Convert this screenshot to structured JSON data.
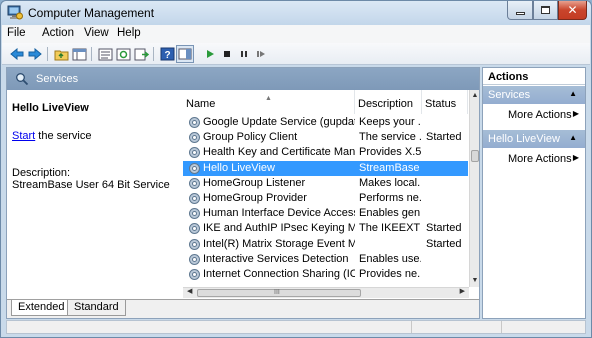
{
  "window": {
    "title": "Computer Management"
  },
  "menu": [
    "File",
    "Action",
    "View",
    "Help"
  ],
  "main": {
    "header_title": "Services",
    "service_name": "Hello LiveView",
    "start_link": "Start",
    "start_rest": " the service",
    "description_label": "Description:",
    "description_text": "StreamBase User 64 Bit Service",
    "columns": {
      "name": "Name",
      "description": "Description",
      "status": "Status"
    },
    "rows": [
      {
        "name": "Google Update Service (gupdatem)",
        "description": "Keeps your ...",
        "status": ""
      },
      {
        "name": "Group Policy Client",
        "description": "The service ...",
        "status": "Started"
      },
      {
        "name": "Health Key and Certificate Manage...",
        "description": "Provides X.5...",
        "status": ""
      },
      {
        "name": "Hello LiveView",
        "description": "StreamBase ...",
        "status": "",
        "selected": true
      },
      {
        "name": "HomeGroup Listener",
        "description": "Makes local...",
        "status": ""
      },
      {
        "name": "HomeGroup Provider",
        "description": "Performs ne...",
        "status": ""
      },
      {
        "name": "Human Interface Device Access",
        "description": "Enables gen...",
        "status": ""
      },
      {
        "name": "IKE and AuthIP IPsec Keying Modul...",
        "description": "The IKEEXT ...",
        "status": "Started"
      },
      {
        "name": "Intel(R) Matrix Storage Event Monitor",
        "description": "",
        "status": "Started"
      },
      {
        "name": "Interactive Services Detection",
        "description": "Enables use...",
        "status": ""
      },
      {
        "name": "Internet Connection Sharing (ICS)",
        "description": "Provides ne...",
        "status": ""
      }
    ],
    "tabs": {
      "extended": "Extended",
      "standard": "Standard"
    },
    "scroll_grip": "III"
  },
  "actions": {
    "heading": "Actions",
    "sections": [
      {
        "title": "Services",
        "item": "More Actions"
      },
      {
        "title": "Hello LiveView",
        "item": "More Actions"
      }
    ]
  },
  "colors": {
    "selection": "#3399ff",
    "header_band": "#8ca6c3",
    "link": "#0000ee"
  }
}
